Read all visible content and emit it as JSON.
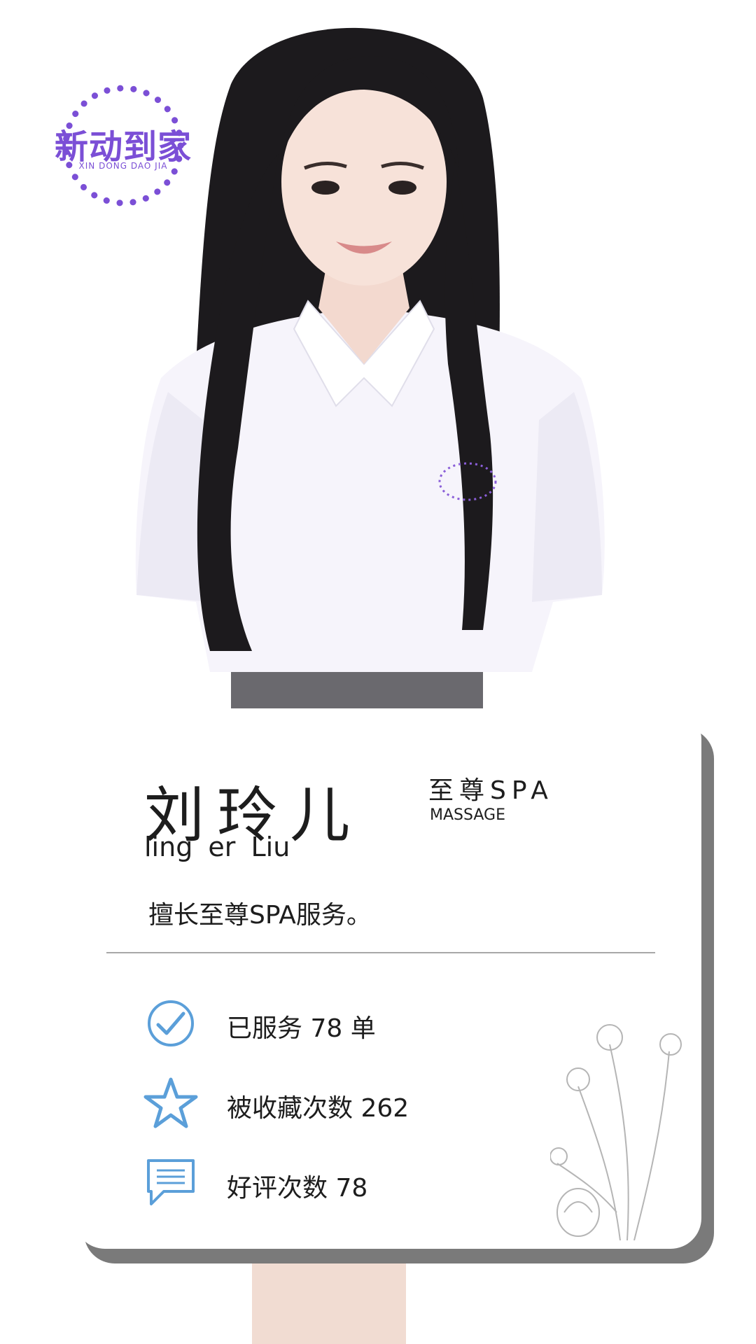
{
  "brand": {
    "name": "新动到家",
    "pinyin": "XIN DONG DAO JIA",
    "color": "#7b4fd6"
  },
  "profile": {
    "name": "刘玲儿",
    "pinyin": "ling  er  Liu",
    "service_cn": "至尊SPA",
    "service_en": "MASSAGE",
    "bio": "擅长至尊SPA服务。"
  },
  "stats": [
    {
      "icon": "check-circle-icon",
      "text": "已服务 78 单"
    },
    {
      "icon": "star-icon",
      "text": "被收藏次数 262"
    },
    {
      "icon": "comment-icon",
      "text": "好评次数 78"
    }
  ],
  "colors": {
    "icon_blue": "#5b9fd9",
    "shadow_gray": "#7a7a7a",
    "text": "#1d1d1d"
  }
}
